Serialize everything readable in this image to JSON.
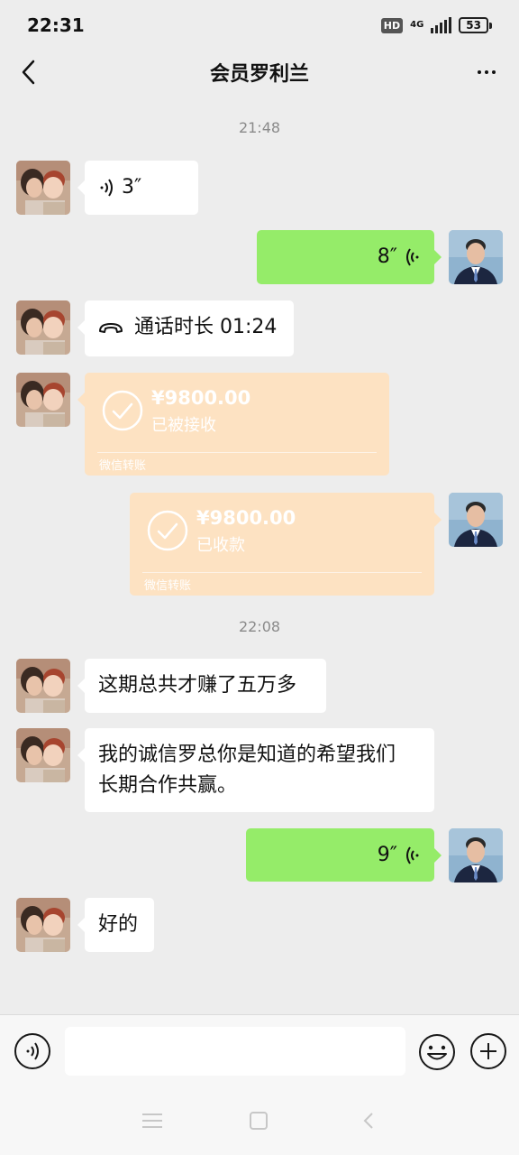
{
  "status_bar": {
    "time": "22:31",
    "hd": "HD",
    "network": "4G",
    "battery": "53"
  },
  "header": {
    "title": "会员罗利兰"
  },
  "messages": [
    {
      "type": "timestamp",
      "text": "21:48"
    },
    {
      "type": "voice",
      "side": "in",
      "duration": "3″"
    },
    {
      "type": "voice",
      "side": "out",
      "duration": "8″"
    },
    {
      "type": "call",
      "side": "in",
      "text": "通话时长 01:24"
    },
    {
      "type": "transfer",
      "side": "in",
      "amount": "¥9800.00",
      "status": "已被接收",
      "brand": "微信转账"
    },
    {
      "type": "transfer",
      "side": "out",
      "amount": "¥9800.00",
      "status": "已收款",
      "brand": "微信转账"
    },
    {
      "type": "timestamp",
      "text": "22:08"
    },
    {
      "type": "text",
      "side": "in",
      "text": "这期总共才赚了五万多"
    },
    {
      "type": "text",
      "side": "in",
      "lines": [
        "我的诚信罗总你是知道的希望我们",
        "长期合作共赢。"
      ]
    },
    {
      "type": "voice",
      "side": "out",
      "duration": "9″"
    },
    {
      "type": "text",
      "side": "in",
      "text": "好的"
    }
  ],
  "input_bar": {
    "value": "",
    "placeholder": ""
  },
  "colors": {
    "out_bubble": "#95ec69",
    "in_bubble": "#ffffff",
    "transfer": "#fde2c2",
    "background": "#ededed"
  }
}
